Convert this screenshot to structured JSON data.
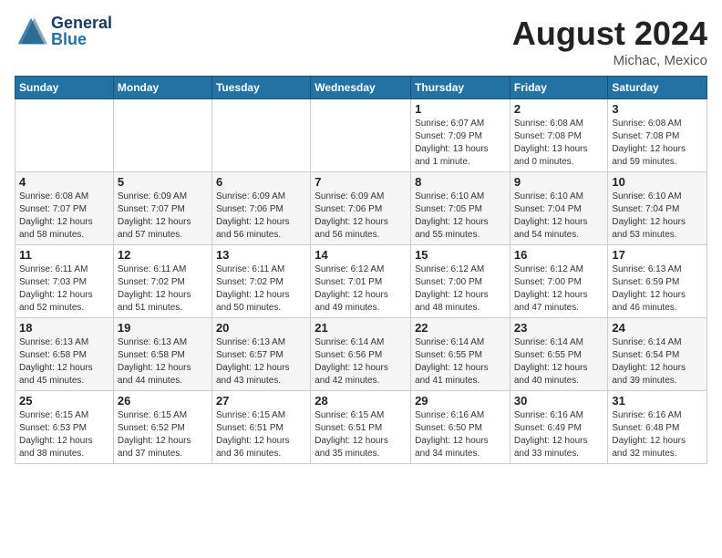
{
  "header": {
    "logo": {
      "general": "General",
      "blue": "Blue"
    },
    "title": "August 2024",
    "subtitle": "Michac, Mexico"
  },
  "calendar": {
    "days_of_week": [
      "Sunday",
      "Monday",
      "Tuesday",
      "Wednesday",
      "Thursday",
      "Friday",
      "Saturday"
    ],
    "weeks": [
      [
        {
          "day": "",
          "info": ""
        },
        {
          "day": "",
          "info": ""
        },
        {
          "day": "",
          "info": ""
        },
        {
          "day": "",
          "info": ""
        },
        {
          "day": "1",
          "info": "Sunrise: 6:07 AM\nSunset: 7:09 PM\nDaylight: 13 hours\nand 1 minute."
        },
        {
          "day": "2",
          "info": "Sunrise: 6:08 AM\nSunset: 7:08 PM\nDaylight: 13 hours\nand 0 minutes."
        },
        {
          "day": "3",
          "info": "Sunrise: 6:08 AM\nSunset: 7:08 PM\nDaylight: 12 hours\nand 59 minutes."
        }
      ],
      [
        {
          "day": "4",
          "info": "Sunrise: 6:08 AM\nSunset: 7:07 PM\nDaylight: 12 hours\nand 58 minutes."
        },
        {
          "day": "5",
          "info": "Sunrise: 6:09 AM\nSunset: 7:07 PM\nDaylight: 12 hours\nand 57 minutes."
        },
        {
          "day": "6",
          "info": "Sunrise: 6:09 AM\nSunset: 7:06 PM\nDaylight: 12 hours\nand 56 minutes."
        },
        {
          "day": "7",
          "info": "Sunrise: 6:09 AM\nSunset: 7:06 PM\nDaylight: 12 hours\nand 56 minutes."
        },
        {
          "day": "8",
          "info": "Sunrise: 6:10 AM\nSunset: 7:05 PM\nDaylight: 12 hours\nand 55 minutes."
        },
        {
          "day": "9",
          "info": "Sunrise: 6:10 AM\nSunset: 7:04 PM\nDaylight: 12 hours\nand 54 minutes."
        },
        {
          "day": "10",
          "info": "Sunrise: 6:10 AM\nSunset: 7:04 PM\nDaylight: 12 hours\nand 53 minutes."
        }
      ],
      [
        {
          "day": "11",
          "info": "Sunrise: 6:11 AM\nSunset: 7:03 PM\nDaylight: 12 hours\nand 52 minutes."
        },
        {
          "day": "12",
          "info": "Sunrise: 6:11 AM\nSunset: 7:02 PM\nDaylight: 12 hours\nand 51 minutes."
        },
        {
          "day": "13",
          "info": "Sunrise: 6:11 AM\nSunset: 7:02 PM\nDaylight: 12 hours\nand 50 minutes."
        },
        {
          "day": "14",
          "info": "Sunrise: 6:12 AM\nSunset: 7:01 PM\nDaylight: 12 hours\nand 49 minutes."
        },
        {
          "day": "15",
          "info": "Sunrise: 6:12 AM\nSunset: 7:00 PM\nDaylight: 12 hours\nand 48 minutes."
        },
        {
          "day": "16",
          "info": "Sunrise: 6:12 AM\nSunset: 7:00 PM\nDaylight: 12 hours\nand 47 minutes."
        },
        {
          "day": "17",
          "info": "Sunrise: 6:13 AM\nSunset: 6:59 PM\nDaylight: 12 hours\nand 46 minutes."
        }
      ],
      [
        {
          "day": "18",
          "info": "Sunrise: 6:13 AM\nSunset: 6:58 PM\nDaylight: 12 hours\nand 45 minutes."
        },
        {
          "day": "19",
          "info": "Sunrise: 6:13 AM\nSunset: 6:58 PM\nDaylight: 12 hours\nand 44 minutes."
        },
        {
          "day": "20",
          "info": "Sunrise: 6:13 AM\nSunset: 6:57 PM\nDaylight: 12 hours\nand 43 minutes."
        },
        {
          "day": "21",
          "info": "Sunrise: 6:14 AM\nSunset: 6:56 PM\nDaylight: 12 hours\nand 42 minutes."
        },
        {
          "day": "22",
          "info": "Sunrise: 6:14 AM\nSunset: 6:55 PM\nDaylight: 12 hours\nand 41 minutes."
        },
        {
          "day": "23",
          "info": "Sunrise: 6:14 AM\nSunset: 6:55 PM\nDaylight: 12 hours\nand 40 minutes."
        },
        {
          "day": "24",
          "info": "Sunrise: 6:14 AM\nSunset: 6:54 PM\nDaylight: 12 hours\nand 39 minutes."
        }
      ],
      [
        {
          "day": "25",
          "info": "Sunrise: 6:15 AM\nSunset: 6:53 PM\nDaylight: 12 hours\nand 38 minutes."
        },
        {
          "day": "26",
          "info": "Sunrise: 6:15 AM\nSunset: 6:52 PM\nDaylight: 12 hours\nand 37 minutes."
        },
        {
          "day": "27",
          "info": "Sunrise: 6:15 AM\nSunset: 6:51 PM\nDaylight: 12 hours\nand 36 minutes."
        },
        {
          "day": "28",
          "info": "Sunrise: 6:15 AM\nSunset: 6:51 PM\nDaylight: 12 hours\nand 35 minutes."
        },
        {
          "day": "29",
          "info": "Sunrise: 6:16 AM\nSunset: 6:50 PM\nDaylight: 12 hours\nand 34 minutes."
        },
        {
          "day": "30",
          "info": "Sunrise: 6:16 AM\nSunset: 6:49 PM\nDaylight: 12 hours\nand 33 minutes."
        },
        {
          "day": "31",
          "info": "Sunrise: 6:16 AM\nSunset: 6:48 PM\nDaylight: 12 hours\nand 32 minutes."
        }
      ]
    ]
  }
}
